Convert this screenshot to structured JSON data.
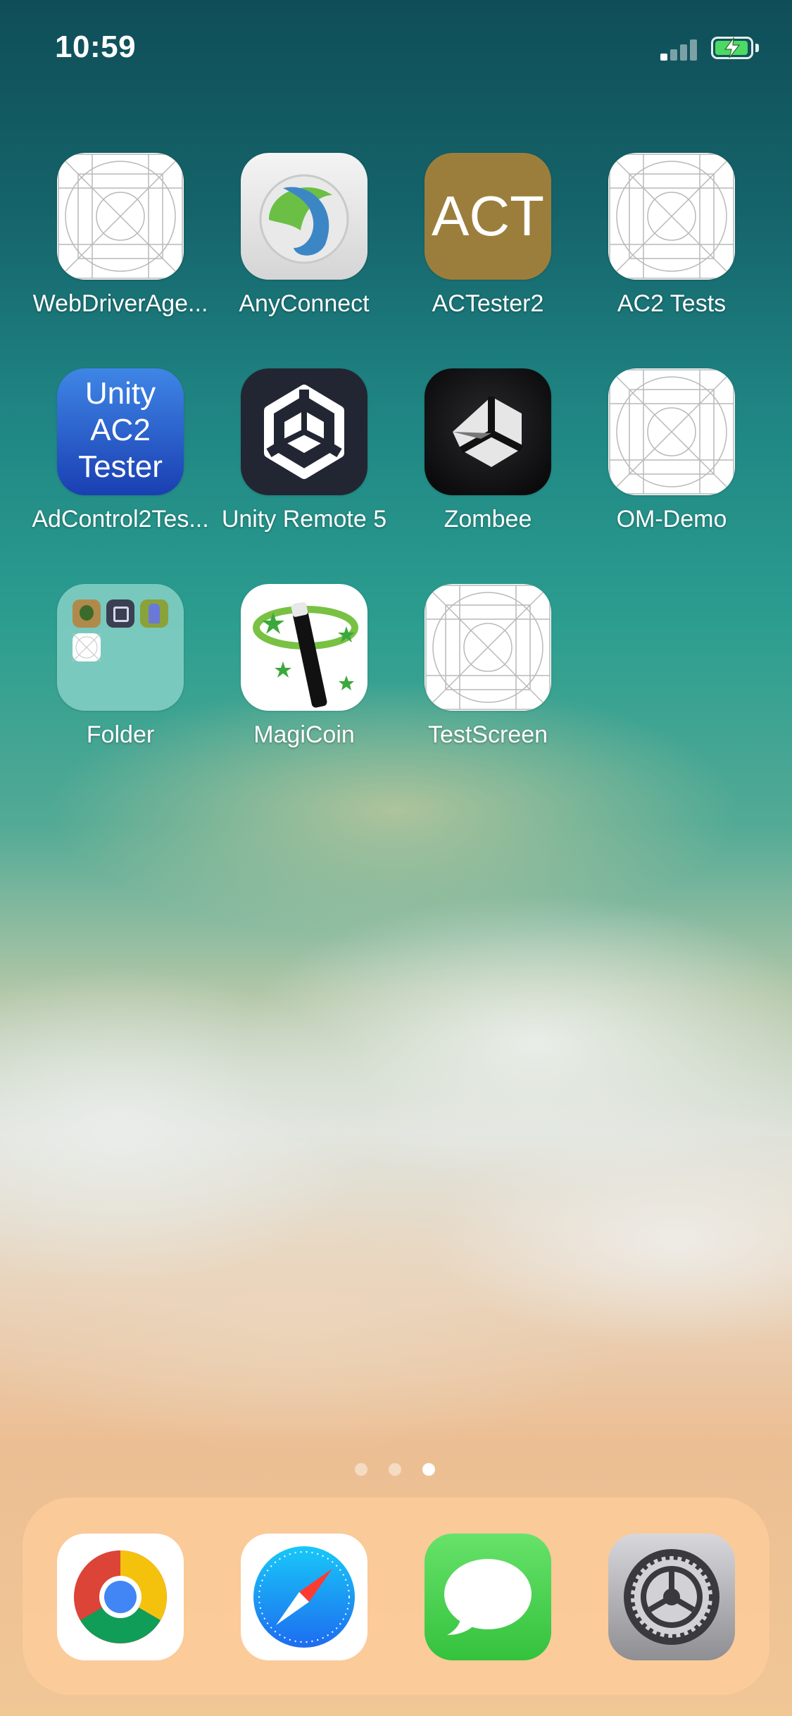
{
  "status_bar": {
    "time": "10:59"
  },
  "apps": [
    {
      "id": "webdriver",
      "label": "WebDriverAge...",
      "icon": "placeholder-grid-icon"
    },
    {
      "id": "anyconnect",
      "label": "AnyConnect",
      "icon": "anyconnect-icon"
    },
    {
      "id": "actester2",
      "label": "ACTester2",
      "icon": "act-icon",
      "icon_text": "ACT"
    },
    {
      "id": "ac2-tests",
      "label": "AC2 Tests",
      "icon": "placeholder-grid-icon"
    },
    {
      "id": "adcontrol2",
      "label": "AdControl2Tes...",
      "icon": "unity-ac2-tester-icon",
      "icon_text": [
        "Unity",
        "AC2",
        "Tester"
      ]
    },
    {
      "id": "unity-remote",
      "label": "Unity Remote 5",
      "icon": "unity-logo-icon"
    },
    {
      "id": "zombee",
      "label": "Zombee",
      "icon": "unity-logo-dark-icon"
    },
    {
      "id": "om-demo",
      "label": "OM-Demo",
      "icon": "placeholder-grid-icon"
    },
    {
      "id": "folder",
      "label": "Folder",
      "icon": "folder-icon"
    },
    {
      "id": "magicoin",
      "label": "MagiCoin",
      "icon": "magic-wand-icon"
    },
    {
      "id": "testscreen",
      "label": "TestScreen",
      "icon": "placeholder-grid-icon"
    }
  ],
  "page_indicator": {
    "count": 3,
    "current": 3
  },
  "dock": [
    {
      "id": "chrome",
      "icon": "chrome-icon"
    },
    {
      "id": "safari",
      "icon": "safari-compass-icon"
    },
    {
      "id": "messages",
      "icon": "messages-bubble-icon"
    },
    {
      "id": "settings",
      "icon": "settings-gear-icon"
    }
  ],
  "colors": {
    "act_icon_bg": "#9c7e3c",
    "unity_ac2_bg": "#1b4fc4",
    "unity_remote_bg": "#222633",
    "zombee_bg": "#0d0d0f",
    "folder_bg": "#7ec9bf",
    "messages_green": "#4cd964",
    "safari_blue": "#1d82f2"
  }
}
